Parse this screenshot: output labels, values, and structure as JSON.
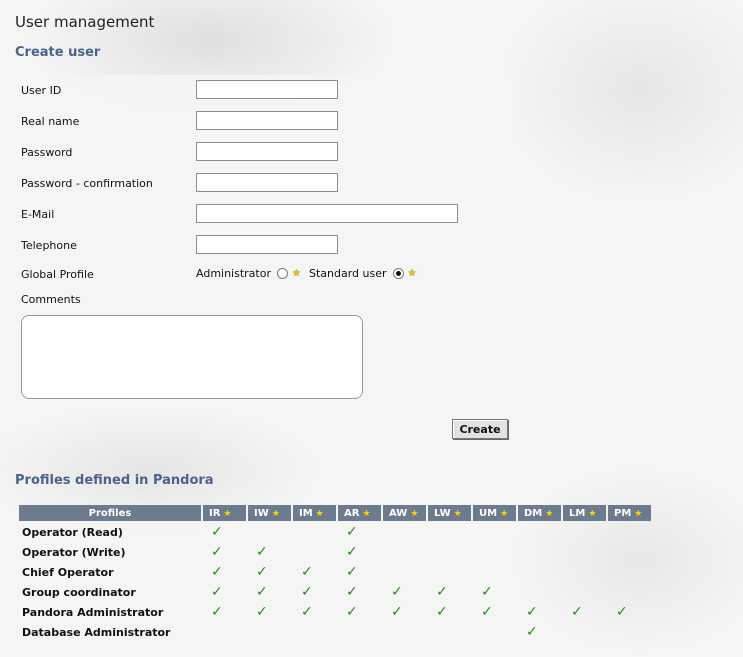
{
  "page": {
    "title": "User management"
  },
  "create_user": {
    "heading": "Create user",
    "fields": {
      "user_id": {
        "label": "User ID",
        "value": ""
      },
      "real_name": {
        "label": "Real name",
        "value": ""
      },
      "password": {
        "label": "Password",
        "value": ""
      },
      "password_confirm": {
        "label": "Password - confirmation",
        "value": ""
      },
      "email": {
        "label": "E-Mail",
        "value": ""
      },
      "telephone": {
        "label": "Telephone",
        "value": ""
      },
      "comments": {
        "label": "Comments",
        "value": ""
      }
    },
    "global_profile": {
      "label": "Global Profile",
      "options": [
        "Administrator",
        "Standard user"
      ],
      "selected": "Standard user"
    },
    "create_button": "Create"
  },
  "profiles": {
    "heading": "Profiles defined in Pandora",
    "header": "Profiles",
    "permissions": [
      "IR",
      "IW",
      "IM",
      "AR",
      "AW",
      "LW",
      "UM",
      "DM",
      "LM",
      "PM"
    ],
    "rows": [
      {
        "name": "Operator (Read)",
        "perms": [
          true,
          false,
          false,
          true,
          false,
          false,
          false,
          false,
          false,
          false
        ]
      },
      {
        "name": "Operator (Write)",
        "perms": [
          true,
          true,
          false,
          true,
          false,
          false,
          false,
          false,
          false,
          false
        ]
      },
      {
        "name": "Chief Operator",
        "perms": [
          true,
          true,
          true,
          true,
          false,
          false,
          false,
          false,
          false,
          false
        ]
      },
      {
        "name": "Group coordinator",
        "perms": [
          true,
          true,
          true,
          true,
          true,
          true,
          true,
          false,
          false,
          false
        ]
      },
      {
        "name": "Pandora Administrator",
        "perms": [
          true,
          true,
          true,
          true,
          true,
          true,
          true,
          true,
          true,
          true
        ]
      },
      {
        "name": "Database Administrator",
        "perms": [
          false,
          false,
          false,
          false,
          false,
          false,
          false,
          true,
          false,
          false
        ]
      }
    ],
    "check_glyph": "✓",
    "star_color": "#f0d000",
    "header_color": "#6c7c8e"
  }
}
